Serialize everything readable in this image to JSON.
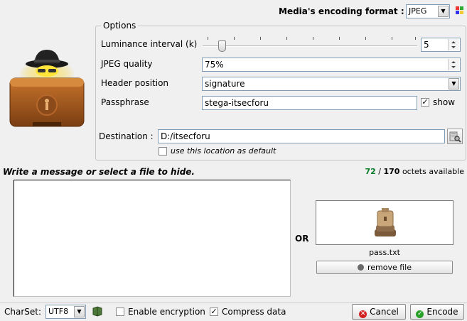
{
  "header": {
    "format_label": "Media's encoding format :",
    "format_value": "JPEG",
    "format_icon": "palette-icon"
  },
  "options": {
    "legend": "Options",
    "luminance_label": "Luminance interval (k)",
    "luminance_value": "5",
    "jpeg_quality_label": "JPEG quality",
    "jpeg_quality_value": "75%",
    "header_position_label": "Header position",
    "header_position_value": "signature",
    "passphrase_label": "Passphrase",
    "passphrase_value": "stega-itsecforu",
    "show_label": "show",
    "show_checked": true,
    "destination_label": "Destination :",
    "destination_value": "D:/itsecforu",
    "default_location_label": "use this location as default",
    "default_location_checked": false
  },
  "message": {
    "title": "Write a message or select a file to hide.",
    "octets_used": "72",
    "octets_sep": " / ",
    "octets_total": "170",
    "octets_suffix": " octets available",
    "or_label": "OR",
    "file_name": "pass.txt",
    "remove_label": "remove file"
  },
  "footer": {
    "charset_label": "CharSet:",
    "charset_value": "UTF8",
    "enable_encryption_label": "Enable encryption",
    "enable_encryption_checked": false,
    "compress_label": "Compress data",
    "compress_checked": true,
    "cancel_label": "Cancel",
    "encode_label": "Encode"
  },
  "colors": {
    "octets_used": "#0a7d2a",
    "cancel_icon": "#d22020",
    "encode_icon": "#2aa02a"
  }
}
